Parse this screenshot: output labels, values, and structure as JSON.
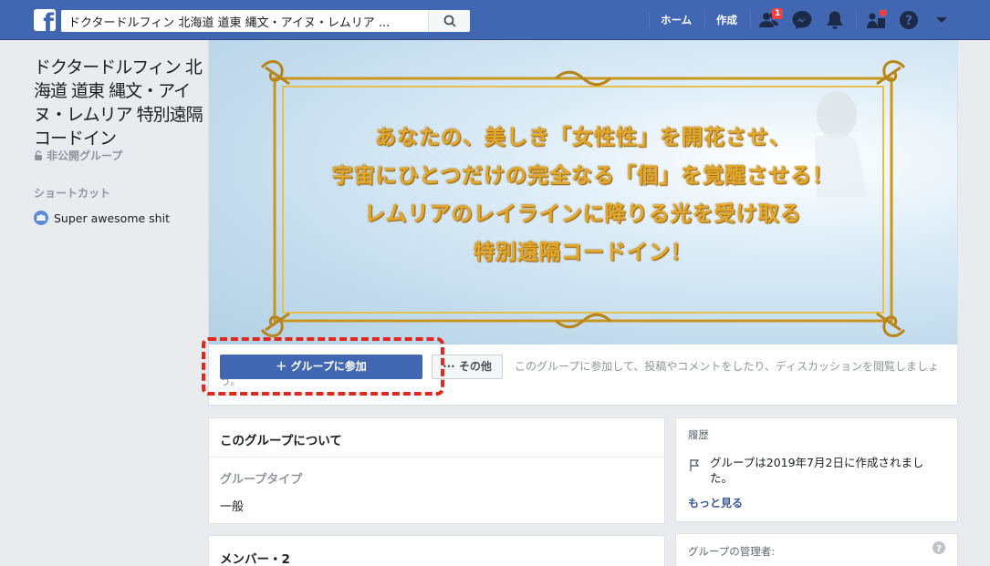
{
  "topbar": {
    "search_value": "ドクタードルフィン 北海道 道東 縄文・アイヌ・レムリア ...",
    "home_label": "ホーム",
    "create_label": "作成",
    "friend_requests_badge": "1",
    "icons": [
      "facebook-logo",
      "search-icon",
      "friends-icon",
      "messenger-icon",
      "notifications-icon",
      "quick-help-icon",
      "help-icon",
      "caret-down-icon"
    ]
  },
  "sidebar": {
    "group_name": "ドクタードルフィン 北海道 道東 縄文・アイヌ・レムリア 特別遠隔コードイン",
    "privacy_label": "非公開グループ",
    "shortcut_title": "ショートカット",
    "shortcut_item": "Super awesome shit"
  },
  "cover": {
    "line1": "あなたの、美しき「女性性」を開花させ、",
    "line2": "宇宙にひとつだけの完全なる「個」を覚醒させる！",
    "line3": "レムリアのレイラインに降りる光を受け取る",
    "line4": "特別遠隔コードイン！"
  },
  "actions": {
    "join_label": "＋ グループに参加",
    "other_label": "··· その他",
    "hint": "このグループに参加して、投稿やコメントをしたり、ディスカッションを閲覧しましょう。"
  },
  "about": {
    "title": "このグループについて",
    "type_label": "グループタイプ",
    "type_value": "一般"
  },
  "members": {
    "title": "メンバー・2"
  },
  "history": {
    "title": "履歴",
    "text": "グループは2019年7月2日に作成されました。",
    "more_label": "もっと見る"
  },
  "admins": {
    "title": "グループの管理者:"
  },
  "colors": {
    "brand": "#4267b2",
    "highlight_dash": "#e0281f",
    "cover_text": "#e2a82c"
  }
}
